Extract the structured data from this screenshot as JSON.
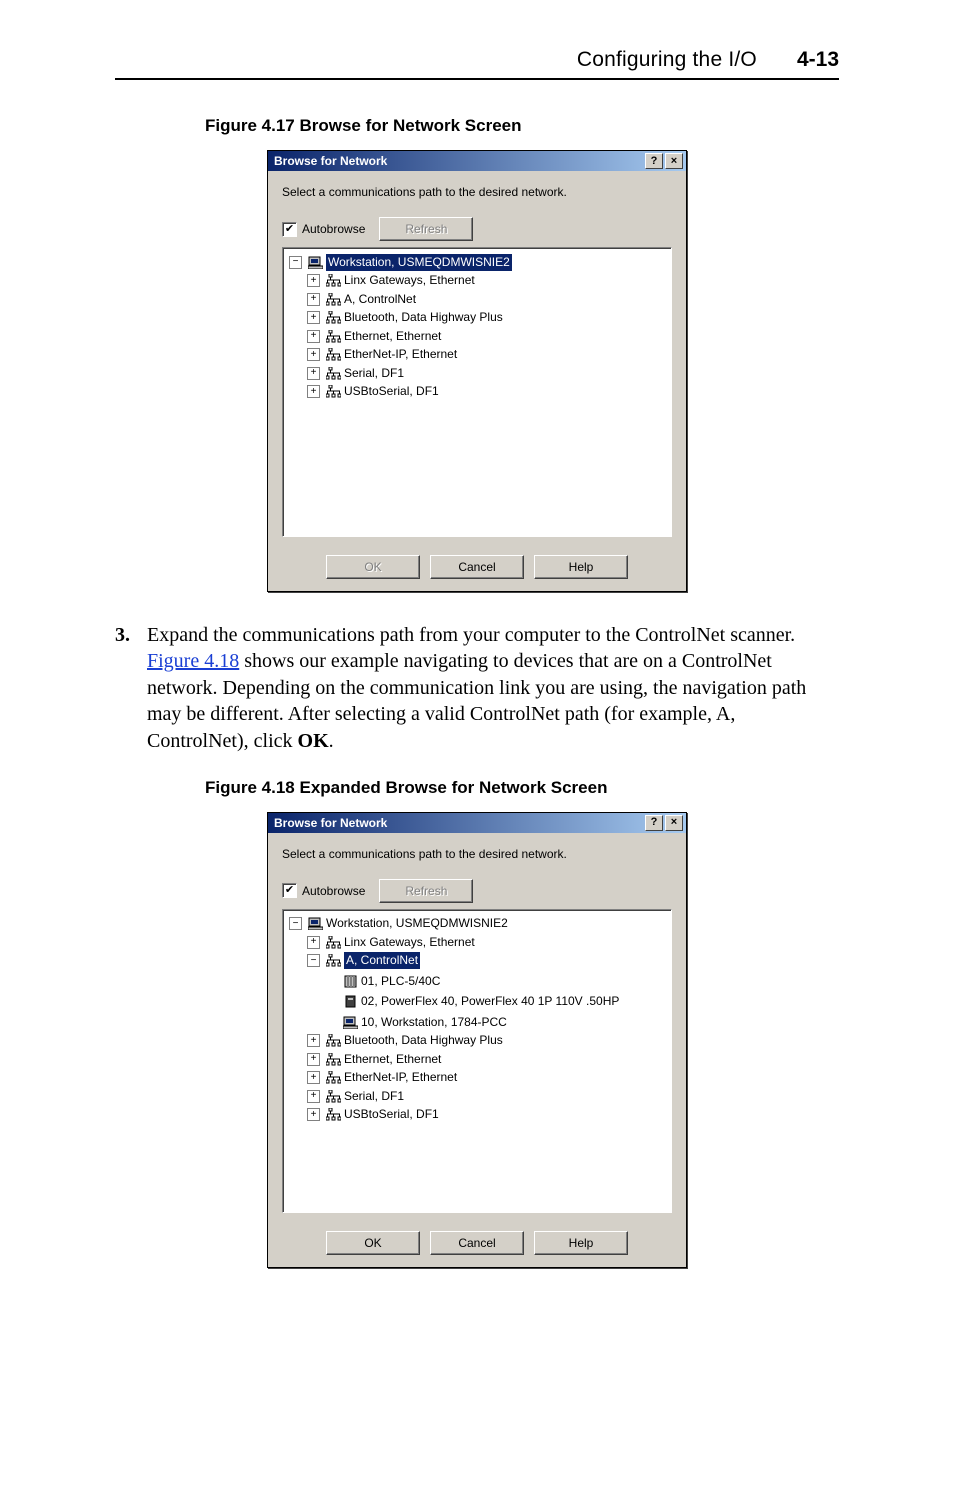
{
  "header": {
    "title": "Configuring the I/O",
    "pagenum": "4-13"
  },
  "fig1": {
    "caption": "Figure 4.17   Browse for Network Screen"
  },
  "fig2": {
    "caption": "Figure 4.18   Expanded Browse for Network Screen"
  },
  "dialog": {
    "title": "Browse for Network",
    "help_btn": "?",
    "close_btn": "×",
    "prompt": "Select a communications path to the desired network.",
    "autobrowse": "Autobrowse",
    "refresh": "Refresh",
    "ok": "OK",
    "cancel": "Cancel",
    "help": "Help"
  },
  "tree1": {
    "root": "Workstation, USMEQDMWISNIE2",
    "items": [
      "Linx Gateways, Ethernet",
      "A, ControlNet",
      "Bluetooth, Data Highway Plus",
      "Ethernet, Ethernet",
      "EtherNet-IP, Ethernet",
      "Serial, DF1",
      "USBtoSerial, DF1"
    ]
  },
  "tree2": {
    "root": "Workstation, USMEQDMWISNIE2",
    "items_top": [
      "Linx Gateways, Ethernet"
    ],
    "controlnet": "A, ControlNet",
    "controlnet_children": [
      "01, PLC-5/40C",
      "02, PowerFlex 40, PowerFlex 40 1P 110V   .50HP",
      "10, Workstation, 1784-PCC"
    ],
    "items_rest": [
      "Bluetooth, Data Highway Plus",
      "Ethernet, Ethernet",
      "EtherNet-IP, Ethernet",
      "Serial, DF1",
      "USBtoSerial, DF1"
    ]
  },
  "para": {
    "num": "3.",
    "parts": {
      "a": "Expand the communications path from your computer to the ControlNet scanner. ",
      "link": "Figure 4.18",
      "b": " shows our example navigating to devices that are on a ControlNet network. Depending on the communication link you are using, the navigation path may be different. After selecting a valid ControlNet path (for example, A, ControlNet), click ",
      "bold": "OK",
      "c": "."
    }
  }
}
